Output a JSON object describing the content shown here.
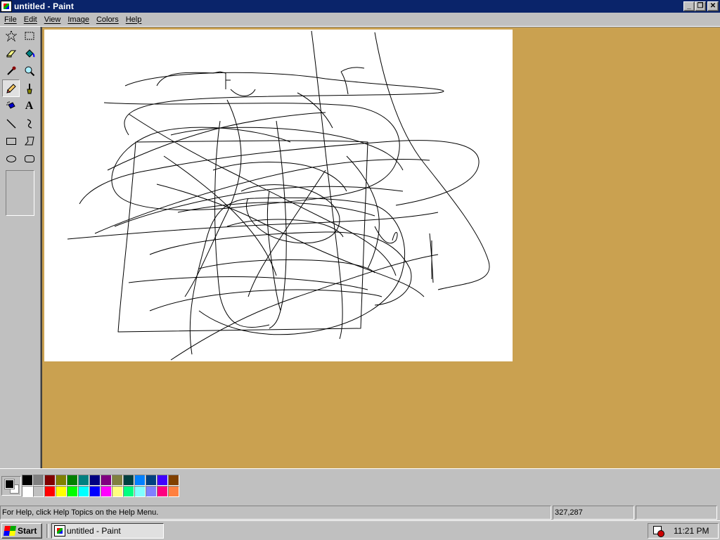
{
  "window": {
    "title": "untitled - Paint",
    "buttons": {
      "minimize": "_",
      "restore": "❐",
      "close": "✕"
    }
  },
  "menu": [
    {
      "label": "File"
    },
    {
      "label": "Edit"
    },
    {
      "label": "View"
    },
    {
      "label": "Image"
    },
    {
      "label": "Colors"
    },
    {
      "label": "Help"
    }
  ],
  "tools": [
    {
      "name": "free-form-select",
      "icon": "star-select-icon"
    },
    {
      "name": "select",
      "icon": "rect-select-icon"
    },
    {
      "name": "eraser",
      "icon": "eraser-icon"
    },
    {
      "name": "fill-with-color",
      "icon": "paint-bucket-icon"
    },
    {
      "name": "pick-color",
      "icon": "eyedropper-icon"
    },
    {
      "name": "magnifier",
      "icon": "magnifier-icon"
    },
    {
      "name": "pencil",
      "icon": "pencil-icon",
      "active": true
    },
    {
      "name": "brush",
      "icon": "brush-icon"
    },
    {
      "name": "airbrush",
      "icon": "airbrush-icon"
    },
    {
      "name": "text",
      "icon": "text-icon",
      "glyph": "A"
    },
    {
      "name": "line",
      "icon": "line-icon"
    },
    {
      "name": "curve",
      "icon": "curve-icon"
    },
    {
      "name": "rectangle",
      "icon": "rectangle-icon"
    },
    {
      "name": "polygon",
      "icon": "polygon-icon"
    },
    {
      "name": "ellipse",
      "icon": "ellipse-icon"
    },
    {
      "name": "rounded-rectangle",
      "icon": "rounded-rectangle-icon"
    }
  ],
  "colors": {
    "workspace": "#caa150",
    "canvas": "#ffffff",
    "foreground": "#000000",
    "background": "#ffffff",
    "titlebar": "#0a246a"
  },
  "palette": [
    "#000000",
    "#808080",
    "#800000",
    "#808000",
    "#008000",
    "#008080",
    "#000080",
    "#800080",
    "#808040",
    "#004040",
    "#0080ff",
    "#004080",
    "#4000ff",
    "#804000",
    "#ffffff",
    "#c0c0c0",
    "#ff0000",
    "#ffff00",
    "#00ff00",
    "#00ffff",
    "#0000ff",
    "#ff00ff",
    "#ffff80",
    "#00ff80",
    "#80ffff",
    "#8080ff",
    "#ff0080",
    "#ff8040"
  ],
  "status": {
    "help": "For Help, click Help Topics on the Help Menu.",
    "coords": "327,287",
    "size": ""
  },
  "taskbar": {
    "start_label": "Start",
    "task_label": "untitled - Paint",
    "tray_icon": "scheduler-icon",
    "clock": "11:21 PM"
  }
}
